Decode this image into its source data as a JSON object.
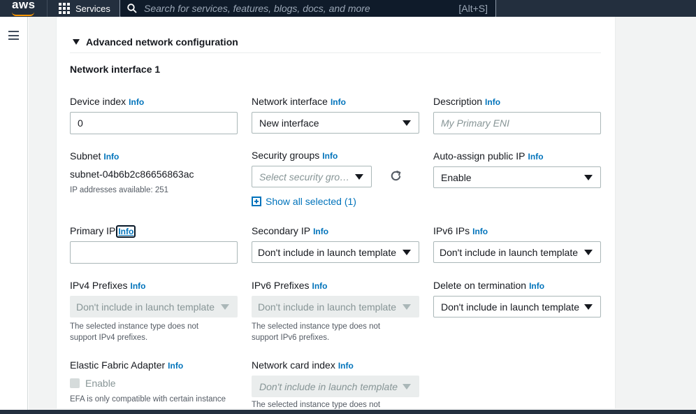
{
  "topnav": {
    "logo_text": "aws",
    "services_label": "Services",
    "search_placeholder": "Search for services, features, blogs, docs, and more",
    "search_shortcut": "[Alt+S]"
  },
  "section": {
    "title": "Advanced network configuration",
    "network_interface_title": "Network interface 1"
  },
  "info_label": "Info",
  "fields": {
    "device_index": {
      "label": "Device index",
      "value": "0"
    },
    "network_interface": {
      "label": "Network interface",
      "value": "New interface"
    },
    "description": {
      "label": "Description",
      "placeholder": "My Primary ENI"
    },
    "subnet": {
      "label": "Subnet",
      "value": "subnet-04b6b2c86656863ac",
      "hint": "IP addresses available: 251"
    },
    "security_groups": {
      "label": "Security groups",
      "placeholder": "Select security groups",
      "show_all": "Show all selected (1)"
    },
    "auto_assign_public_ip": {
      "label": "Auto-assign public IP",
      "value": "Enable"
    },
    "primary_ip": {
      "label": "Primary IP",
      "value": ""
    },
    "secondary_ip": {
      "label": "Secondary IP",
      "value": "Don't include in launch template"
    },
    "ipv6_ips": {
      "label": "IPv6 IPs",
      "value": "Don't include in launch template"
    },
    "ipv4_prefixes": {
      "label": "IPv4 Prefixes",
      "value": "Don't include in launch template",
      "hint_line1": "The selected instance type does not",
      "hint_line2": "support IPv4 prefixes."
    },
    "ipv6_prefixes": {
      "label": "IPv6 Prefixes",
      "value": "Don't include in launch template",
      "hint_line1": "The selected instance type does not",
      "hint_line2": "support IPv6 prefixes."
    },
    "delete_on_termination": {
      "label": "Delete on termination",
      "value": "Don't include in launch template"
    },
    "efa": {
      "label": "Elastic Fabric Adapter",
      "checkbox_label": "Enable",
      "hint": "EFA is only compatible with certain instance"
    },
    "network_card_index": {
      "label": "Network card index",
      "value": "Don't include in launch template",
      "hint": "The selected instance type does not"
    }
  },
  "colors": {
    "nav_bg": "#232f3e",
    "link": "#0073bb",
    "accent": "#ff9900"
  }
}
